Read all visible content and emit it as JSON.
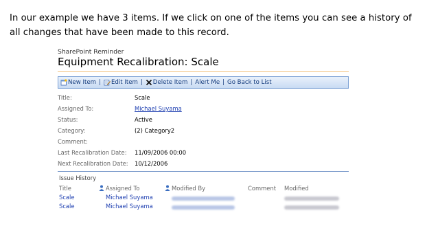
{
  "intro_text": "In our example we have 3 items. If we click on one of the items you can see a history of all changes that have been made to this record.",
  "site_name": "SharePoint Reminder",
  "page_title": "Equipment Recalibration: Scale",
  "toolbar": {
    "new_item": "New Item",
    "edit_item": "Edit Item",
    "delete_item": "Delete Item",
    "alert_me": "Alert Me",
    "back_to_list": "Go Back to List",
    "separator": "|"
  },
  "fields": [
    {
      "label": "Title:",
      "value": "Scale"
    },
    {
      "label": "Assigned To:",
      "value": "Michael Suyama"
    },
    {
      "label": "Status:",
      "value": "Active"
    },
    {
      "label": "Category:",
      "value": "(2) Category2"
    },
    {
      "label": "Comment:",
      "value": ""
    },
    {
      "label": "Last Recalibration Date:",
      "value": "11/09/2006 00:00"
    },
    {
      "label": "Next Recalibration Date:",
      "value": "10/12/2006"
    }
  ],
  "history": {
    "heading": "Issue History",
    "columns": [
      "Title",
      "Assigned To",
      "Modified By",
      "Comment",
      "Modified"
    ],
    "rows": [
      {
        "title": "Scale",
        "assigned_to": "Michael Suyama"
      },
      {
        "title": "Scale",
        "assigned_to": "Michael Suyama"
      }
    ]
  }
}
